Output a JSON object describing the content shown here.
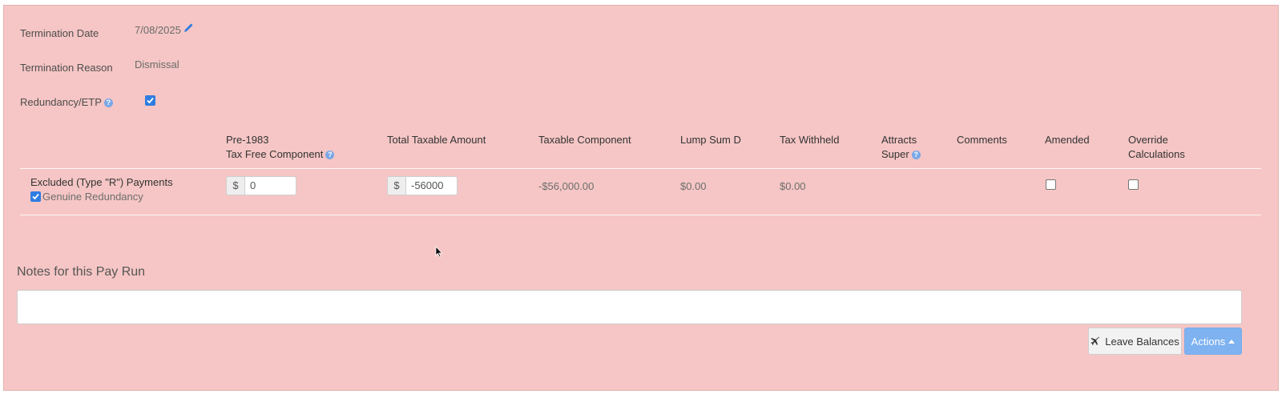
{
  "colors": {
    "panel_background": "#f5c6c5",
    "link_blue": "#2f7de1",
    "primary_button": "#7eb2f0"
  },
  "termination": {
    "date_label": "Termination Date",
    "date_value": "7/08/2025",
    "reason_label": "Termination Reason",
    "reason_value": "Dismissal",
    "redundancy_label": "Redundancy/ETP",
    "redundancy_help": "?",
    "redundancy_checked": true
  },
  "etp_table": {
    "headers": {
      "pre1983_line1": "Pre-1983",
      "pre1983_line2": "Tax Free Component",
      "pre1983_help": "?",
      "total_taxable": "Total Taxable Amount",
      "taxable_component": "Taxable Component",
      "lump_sum_d": "Lump Sum D",
      "tax_withheld": "Tax Withheld",
      "attracts_line1": "Attracts",
      "attracts_line2": "Super",
      "attracts_help": "?",
      "comments": "Comments",
      "amended": "Amended",
      "override_line1": "Override",
      "override_line2": "Calculations"
    },
    "row": {
      "payment_type": "Excluded (Type \"R\") Payments",
      "genuine_redundancy_label": "Genuine Redundancy",
      "genuine_redundancy_checked": true,
      "currency_symbol": "$",
      "pre1983_value": "0",
      "total_taxable_value": "-56000",
      "taxable_component": "-$56,000.00",
      "lump_sum_d": "$0.00",
      "tax_withheld": "$0.00",
      "amended_checked": false,
      "override_checked": false
    }
  },
  "notes": {
    "heading": "Notes for this Pay Run",
    "value": ""
  },
  "buttons": {
    "leave_balances": "Leave Balances",
    "leave_balances_icon": "airplane-icon",
    "actions": "Actions",
    "actions_icon": "caret-up-icon"
  }
}
